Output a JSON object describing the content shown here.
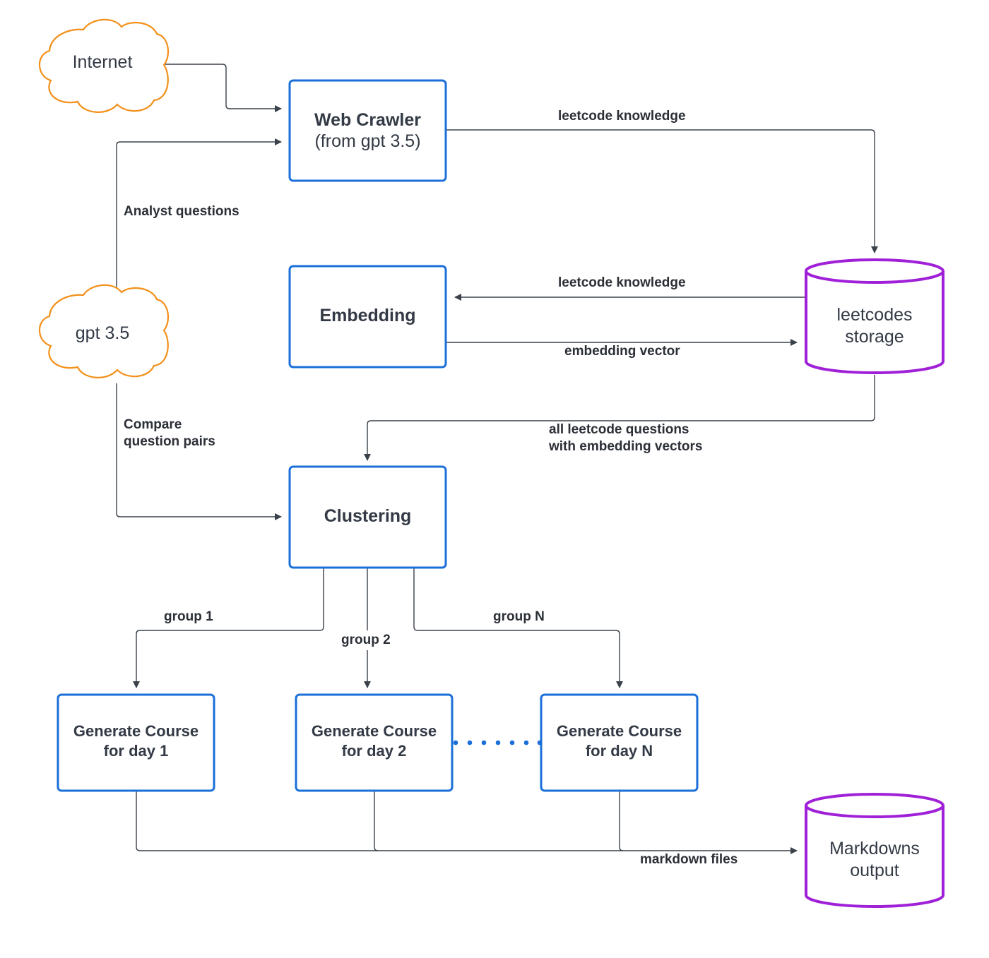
{
  "colors": {
    "process_border": "#1a6fd9",
    "storage_border": "#a020d8",
    "external_border": "#f39019",
    "edge": "#3a414a",
    "text": "#333a45"
  },
  "nodes": {
    "internet": {
      "label": "Internet",
      "shape": "cloud"
    },
    "gpt": {
      "label": "gpt 3.5",
      "shape": "cloud"
    },
    "web_crawler": {
      "title": "Web Crawler",
      "subtitle": "(from gpt 3.5)",
      "shape": "process"
    },
    "embedding": {
      "label": "Embedding",
      "shape": "process"
    },
    "clustering": {
      "label": "Clustering",
      "shape": "process"
    },
    "leetcodes_storage": {
      "label": "leetcodes\nstorage",
      "shape": "database"
    },
    "course_day1": {
      "label": "Generate Course\nfor day 1",
      "shape": "process"
    },
    "course_day2": {
      "label": "Generate Course\nfor day 2",
      "shape": "process"
    },
    "course_dayN": {
      "label": "Generate Course\nfor day N",
      "shape": "process"
    },
    "markdowns_output": {
      "label": "Markdowns\noutput",
      "shape": "database"
    }
  },
  "edges": {
    "crawler_to_storage": "leetcode knowledge",
    "gpt_to_crawler": "Analyst questions",
    "storage_to_embedding": "leetcode knowledge",
    "embedding_to_storage": "embedding vector",
    "storage_to_clustering": "all leetcode questions\nwith embedding vectors",
    "gpt_to_clustering": "Compare\nquestion pairs",
    "group1": "group 1",
    "group2": "group 2",
    "groupN": "group N",
    "to_markdowns": "markdown files"
  }
}
